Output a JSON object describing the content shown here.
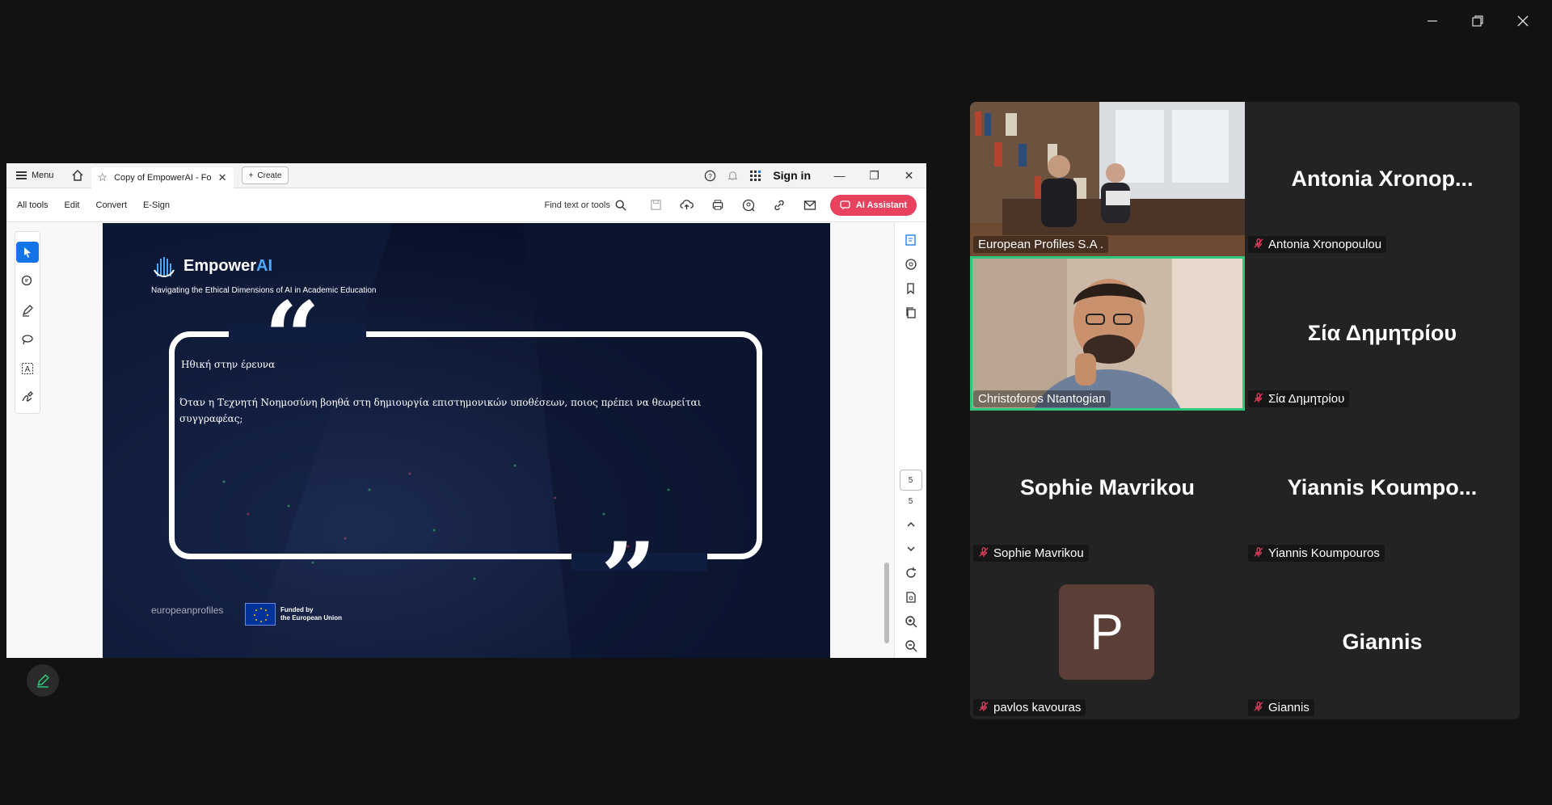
{
  "window": {
    "controls": [
      "minimize",
      "restore",
      "close"
    ]
  },
  "acrobat": {
    "menu_label": "Menu",
    "tab_title": "Copy of EmpowerAI - Fo...",
    "create_label": "Create",
    "sign_in": "Sign in",
    "toolbar_items": [
      "All tools",
      "Edit",
      "Convert",
      "E-Sign"
    ],
    "find_label": "Find text or tools",
    "ai_assistant_label": "AI Assistant",
    "page_current": "5",
    "page_total": "5"
  },
  "slide": {
    "logo_word": "Empower",
    "logo_ai": "AI",
    "subtitle": "Navigating the Ethical Dimensions of AI in Academic Education",
    "quote_heading": "Ηθική στην έρευνα",
    "quote_body": "Όταν η Τεχνητή Νοημοσύνη βοηθά στη δημιουργία επιστημονικών υποθέσεων, ποιος πρέπει να θεωρείται συγγραφέας;",
    "footer_org": "europeanprofiles",
    "eu_funding_line1": "Funded by",
    "eu_funding_line2": "the European Union"
  },
  "participants": [
    {
      "display": "",
      "label": "European Profiles S.A .",
      "muted": false,
      "video": true
    },
    {
      "display": "Antonia  Xronop...",
      "label": "Antonia Xronopoulou",
      "muted": true,
      "video": false
    },
    {
      "display": "",
      "label": "Christoforos Ntantogian",
      "muted": false,
      "video": true,
      "speaking": true
    },
    {
      "display": "Σία Δημητρίου",
      "label": "Σία Δημητρίου",
      "muted": true,
      "video": false
    },
    {
      "display": "Sophie Mavrikou",
      "label": "Sophie Mavrikou",
      "muted": true,
      "video": false
    },
    {
      "display": "Yiannis  Koumpo...",
      "label": "Yiannis Koumpouros",
      "muted": true,
      "video": false
    },
    {
      "display": "P",
      "label": "pavlos kavouras",
      "muted": true,
      "video": false
    },
    {
      "display": "Giannis",
      "label": "Giannis",
      "muted": true,
      "video": false
    }
  ],
  "colors": {
    "speaking_border": "#2fc77b",
    "ai_button": "#e8425e",
    "selected_tool": "#1473e6",
    "avatar_bg": "#5b3f37"
  }
}
